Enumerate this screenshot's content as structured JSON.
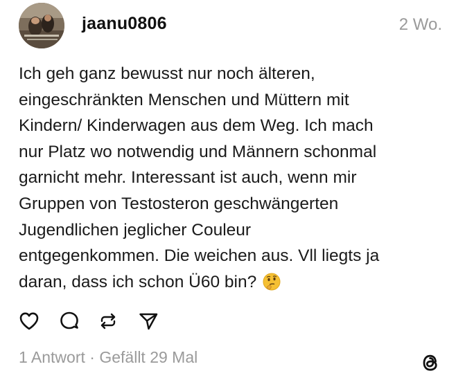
{
  "post": {
    "username": "jaanu0806",
    "timestamp": "2 Wo.",
    "text": "Ich geh ganz bewusst nur noch älteren,\neingeschränkten Menschen und Müttern mit\nKindern/ Kinderwagen aus dem Weg. Ich mach\nnur Platz wo notwendig und Männern schonmal\ngarnicht mehr. Interessant ist auch, wenn mir\nGruppen von Testosteron geschwängerten\nJugendlichen jeglicher Couleur\nentgegenkommen. Die weichen aus. Vll liegts ja\ndaran, dass ich schon Ü60 bin?",
    "emoji": "thinking-face-icon"
  },
  "actions": {
    "like_icon": "heart-icon",
    "reply_icon": "comment-bubble-icon",
    "repost_icon": "repost-arrows-icon",
    "share_icon": "send-arrow-icon"
  },
  "stats": {
    "replies": "1 Antwort",
    "separator": " · ",
    "likes": "Gefällt 29 Mal"
  },
  "brand": {
    "logo_icon": "threads-logo-icon"
  },
  "colors": {
    "text": "#1a1a1a",
    "muted": "#9a9a9a",
    "background": "#ffffff"
  }
}
